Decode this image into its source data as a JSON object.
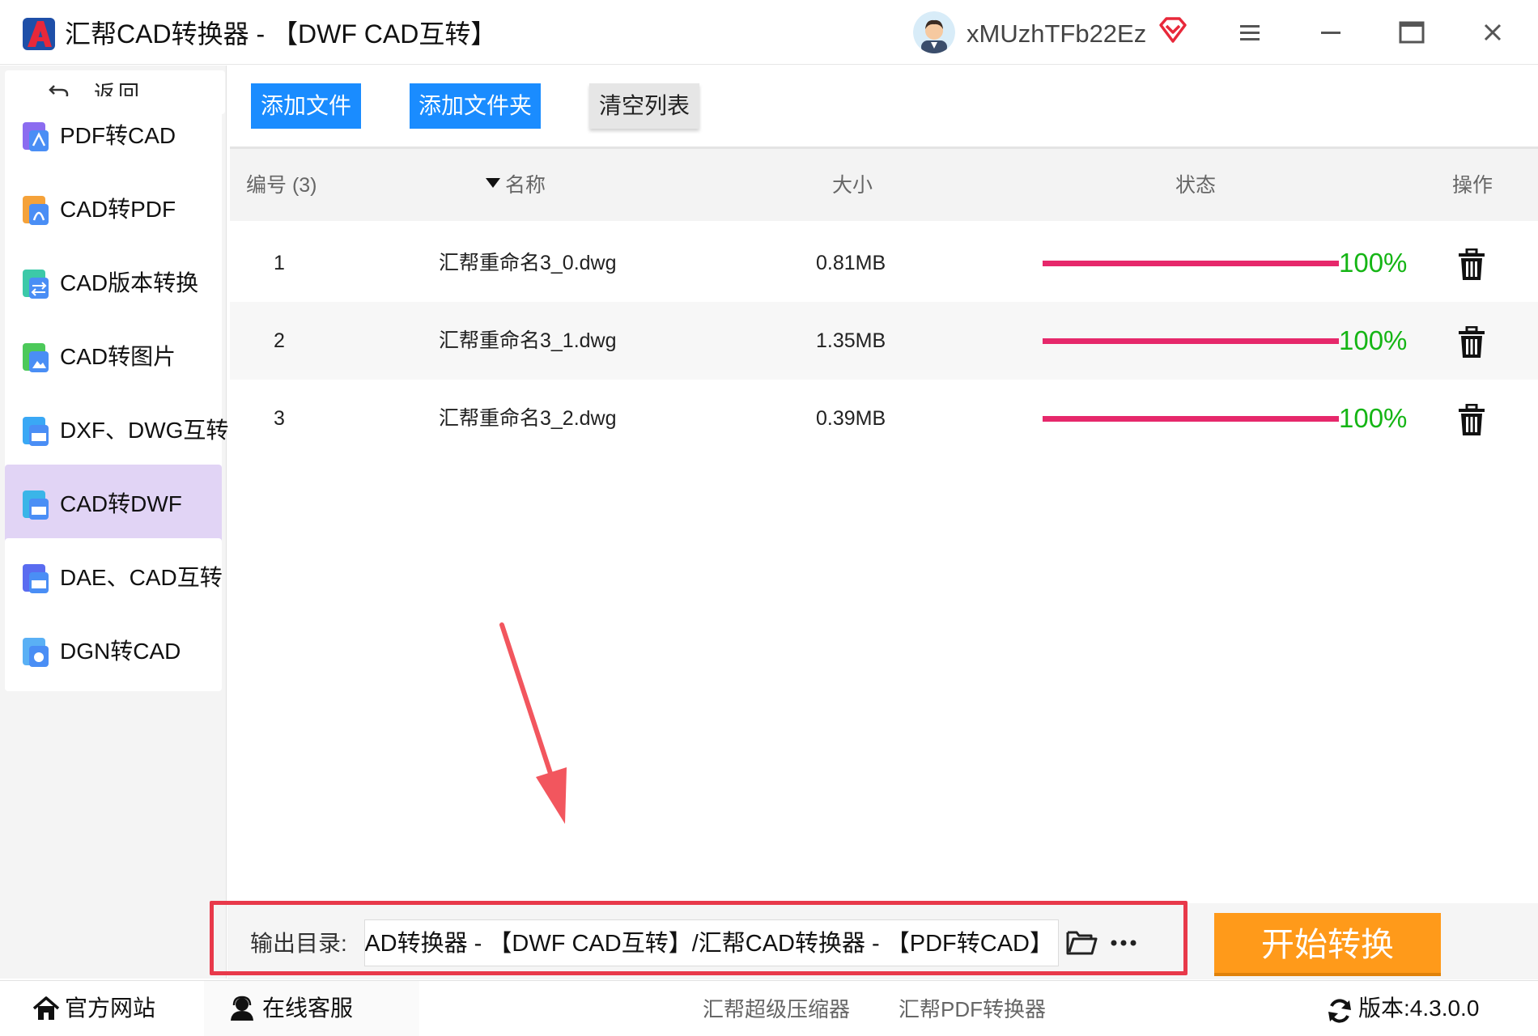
{
  "window": {
    "title": "汇帮CAD转换器 - 【DWF CAD互转】",
    "username": "xMUzhTFb22Ez"
  },
  "sidebar": {
    "back_label": "返回",
    "items": [
      {
        "label": "PDF转CAD",
        "icon": "pdf-to-cad-icon",
        "active": false
      },
      {
        "label": "CAD转PDF",
        "icon": "cad-to-pdf-icon",
        "active": false
      },
      {
        "label": "CAD版本转换",
        "icon": "cad-version-icon",
        "active": false
      },
      {
        "label": "CAD转图片",
        "icon": "cad-to-image-icon",
        "active": false
      },
      {
        "label": "DXF、DWG互转",
        "icon": "dxf-dwg-icon",
        "active": false
      },
      {
        "label": "CAD转DWF",
        "icon": "cad-to-dwf-icon",
        "active": true
      },
      {
        "label": "DAE、CAD互转",
        "icon": "dae-cad-icon",
        "active": false
      },
      {
        "label": "DGN转CAD",
        "icon": "dgn-to-cad-icon",
        "active": false
      }
    ]
  },
  "toolbar": {
    "add_file": "添加文件",
    "add_folder": "添加文件夹",
    "clear_list": "清空列表"
  },
  "table": {
    "headers": {
      "number": "编号 (3)",
      "name": "名称",
      "size": "大小",
      "status": "状态",
      "action": "操作"
    },
    "rows": [
      {
        "number": "1",
        "name": "汇帮重命名3_0.dwg",
        "size": "0.81MB",
        "progress": 1.0,
        "percent": "100%"
      },
      {
        "number": "2",
        "name": "汇帮重命名3_1.dwg",
        "size": "1.35MB",
        "progress": 1.0,
        "percent": "100%"
      },
      {
        "number": "3",
        "name": "汇帮重命名3_2.dwg",
        "size": "0.39MB",
        "progress": 1.0,
        "percent": "100%"
      }
    ]
  },
  "output": {
    "label": "输出目录:",
    "path": "CAD转换器 - 【DWF CAD互转】/汇帮CAD转换器 - 【PDF转CAD】"
  },
  "start_button": "开始转换",
  "footer": {
    "site": "官方网站",
    "service": "在线客服",
    "link_1": "汇帮超级压缩器",
    "link_2": "汇帮PDF转换器",
    "version": "版本:4.3.0.0"
  },
  "colors": {
    "accent_blue": "#1a8cff",
    "start_orange": "#ff9a1a",
    "progress_pink": "#e6286b",
    "percent_green": "#15b515",
    "highlight_red": "#e8394a",
    "active_purple": "#e1d4f5"
  }
}
